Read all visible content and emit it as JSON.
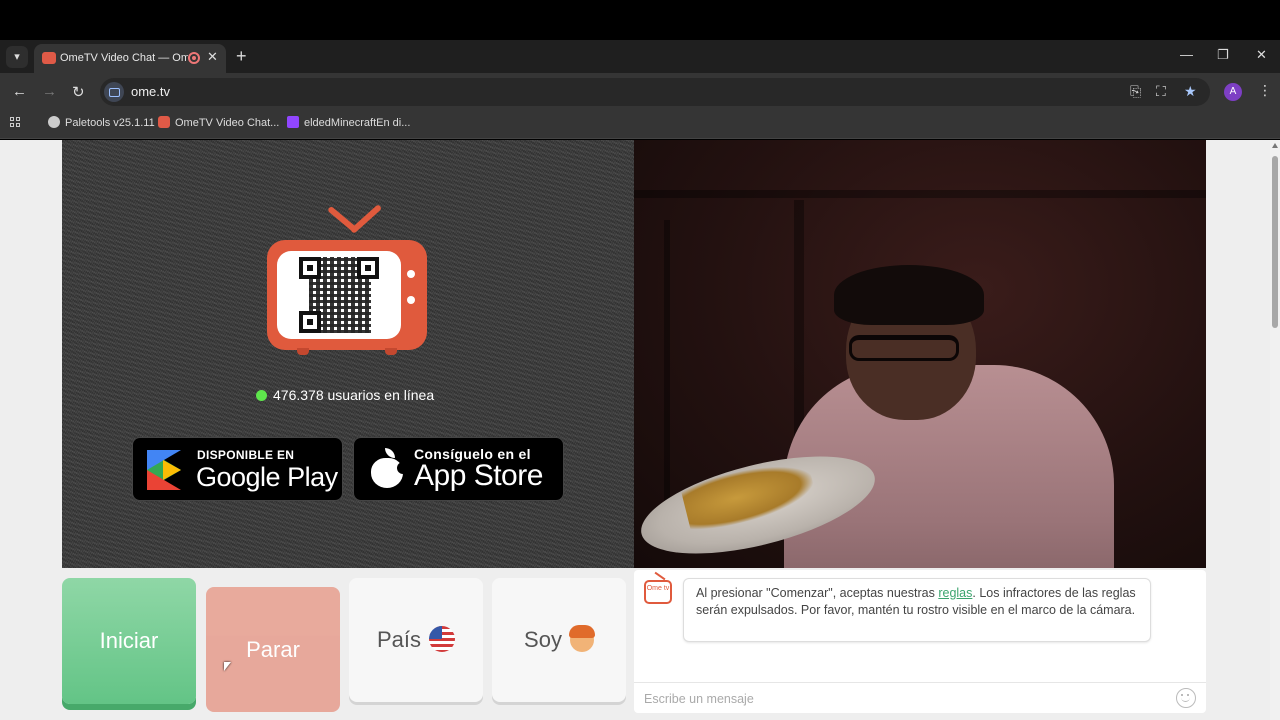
{
  "browser": {
    "tab_title": "OmeTV Video Chat — Ome",
    "url": "ome.tv",
    "avatar_letter": "A",
    "bookmarks": [
      {
        "label": "Paletools v25.1.11"
      },
      {
        "label": "OmeTV Video Chat..."
      },
      {
        "label": "eldedMinecraftEn di..."
      }
    ]
  },
  "left_video": {
    "online_text": "476.378 usuarios en línea",
    "google_play": {
      "small": "DISPONIBLE EN",
      "big": "Google Play"
    },
    "app_store": {
      "small": "Consíguelo en el",
      "big": "App Store"
    }
  },
  "controls": {
    "start": "Iniciar",
    "stop": "Parar",
    "country": "País",
    "gender": "Soy"
  },
  "chat": {
    "logo_text": "Ome tv",
    "message_part1": "Al presionar \"Comenzar\", aceptas nuestras ",
    "message_link": "reglas",
    "message_part2": ". Los infractores de las reglas serán expulsados. Por favor, mantén tu rostro visible en el marco de la cámara.",
    "input_placeholder": "Escribe un mensaje"
  },
  "colors": {
    "brand": "#e05a3d",
    "start_green": "#63c486",
    "stop_salmon": "#e7a597",
    "online_dot": "#5ee64c",
    "link_green": "#3ba46e"
  }
}
